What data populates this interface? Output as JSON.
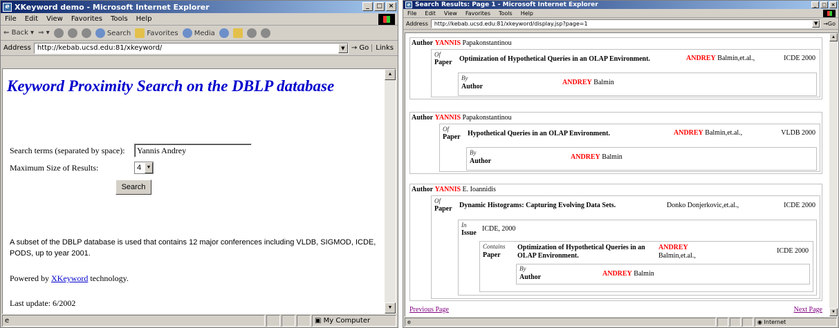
{
  "left": {
    "title": "XKeyword demo - Microsoft Internet Explorer",
    "menu": [
      "File",
      "Edit",
      "View",
      "Favorites",
      "Tools",
      "Help"
    ],
    "toolbar": {
      "back": "Back",
      "search": "Search",
      "favorites": "Favorites",
      "media": "Media"
    },
    "address_label": "Address",
    "url": "http://kebab.ucsd.edu:81/xkeyword/",
    "go": "Go",
    "links": "Links",
    "heading": "Keyword Proximity Search on the DBLP database",
    "search_label": "Search terms (separated by space):",
    "search_value": "Yannis Andrey",
    "max_label": "Maximum Size of Results:",
    "max_value": "4",
    "search_button": "Search",
    "desc": "A subset of the DBLP database is used that contains 12 major conferences including VLDB, SIGMOD, ICDE, PODS, up to year 2001.",
    "powered_pre": "Powered by",
    "powered_link": "XKeyword",
    "powered_post": "technology.",
    "last_update": "Last update:  6/2002",
    "status_zone": "My Computer"
  },
  "right": {
    "title": "Search Results: Page 1 - Microsoft Internet Explorer",
    "menu": [
      "File",
      "Edit",
      "View",
      "Favorites",
      "Tools",
      "Help"
    ],
    "address_label": "Address",
    "url": "http://kebab.ucsd.edu:81/xkeyword/display.jsp?page=1",
    "go": "Go",
    "results": [
      {
        "author_label": "Author",
        "author_key": "YANNIS",
        "author_rest": "Papakonstantinou",
        "of": "Of",
        "paper_label": "Paper",
        "paper_title": "Optimization of Hypothetical Queries in an OLAP Environment.",
        "paper_key": "ANDREY",
        "paper_authors": "Balmin,et.al.,",
        "paper_venue": "ICDE 2000",
        "by": "By",
        "by_author_label": "Author",
        "by_key": "ANDREY",
        "by_rest": "Balmin"
      },
      {
        "author_label": "Author",
        "author_key": "YANNIS",
        "author_rest": "Papakonstantinou",
        "of": "Of",
        "paper_label": "Paper",
        "paper_title": "Hypothetical Queries in an OLAP Environment.",
        "paper_key": "ANDREY",
        "paper_authors": "Balmin,et.al.,",
        "paper_venue": "VLDB  2000",
        "by": "By",
        "by_author_label": "Author",
        "by_key": "ANDREY",
        "by_rest": "Balmin"
      },
      {
        "author_label": "Author",
        "author_key": "YANNIS",
        "author_rest": "E. Ioannidis",
        "of": "Of",
        "paper_label": "Paper",
        "paper_title": "Dynamic Histograms: Capturing Evolving Data Sets.",
        "paper_authors": "Donko Donjerkovic,et.al.,",
        "paper_venue": "ICDE  2000",
        "in": "In",
        "issue_label": "Issue",
        "issue_value": "ICDE, 2000",
        "contains": "Contains",
        "contains_label": "Paper",
        "c_title": "Optimization of Hypothetical Queries in an OLAP Environment.",
        "c_key": "ANDREY",
        "c_authors": "Balmin,et.al.,",
        "c_venue": "ICDE 2000",
        "by": "By",
        "by_author_label": "Author",
        "by_key": "ANDREY",
        "by_rest": "Balmin"
      }
    ],
    "prev": "Previous Page",
    "next": "Next Page",
    "status_zone": "Internet"
  }
}
